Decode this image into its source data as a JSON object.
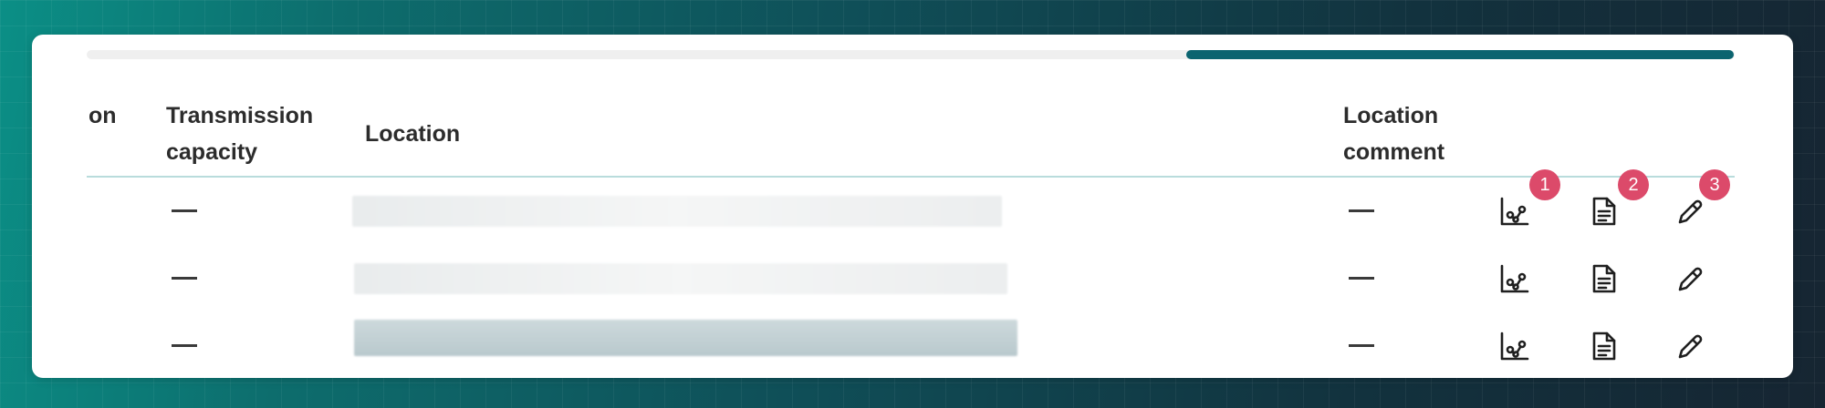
{
  "table": {
    "columns": {
      "partial": "on",
      "transmission": "Transmission\ncapacity",
      "location": "Location",
      "location_comment": "Location\ncomment"
    },
    "rows": [
      {
        "transmission": "—",
        "location_comment": "—"
      },
      {
        "transmission": "—",
        "location_comment": "—"
      },
      {
        "transmission": "—",
        "location_comment": "—"
      }
    ]
  },
  "actions": [
    {
      "icon": "chart-icon"
    },
    {
      "icon": "document-icon"
    },
    {
      "icon": "pencil-icon"
    }
  ],
  "badges": [
    "1",
    "2",
    "3"
  ],
  "colors": {
    "accent": "#0b6470",
    "badge": "#dc4a6a",
    "divider": "#b9dcdc"
  }
}
